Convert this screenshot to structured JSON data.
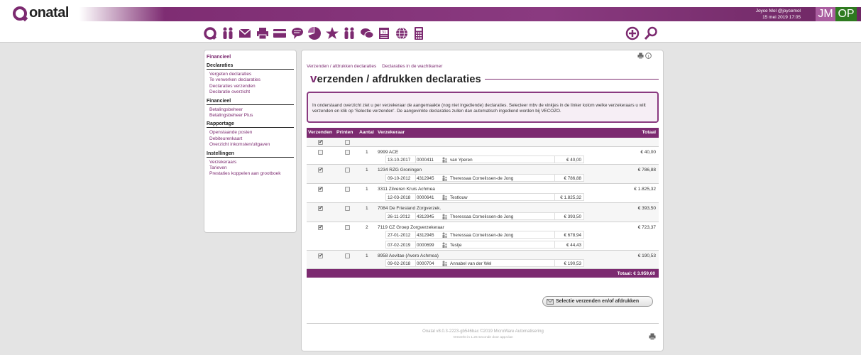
{
  "brand": {
    "name": "onatal",
    "color": "#7c2a70"
  },
  "user": {
    "name": "Joyce Mol @joycemol",
    "datetime": "15 mei 2019 17:05",
    "avatars": [
      "JM",
      "OP"
    ]
  },
  "toolbar": {
    "icons": [
      "onatal-q-icon",
      "clients-icon",
      "mail-icon",
      "print-icon",
      "card-icon",
      "chat-icon",
      "chart-icon",
      "star-icon",
      "group-icon",
      "messages-icon",
      "calendar-icon",
      "globe-icon",
      "calculator-icon"
    ],
    "right_icons": [
      "add-icon",
      "search-icon"
    ]
  },
  "sidebar": {
    "title": "Financieel",
    "sections": [
      {
        "heading": "Declaraties",
        "items": [
          "Vergeten declaraties",
          "Te verwerken declaraties",
          "Declaraties verzenden",
          "Declaratie overzicht"
        ]
      },
      {
        "heading": "Financieel",
        "items": [
          "Betalingsbeheer",
          "Betalingsbeheer Plus"
        ]
      },
      {
        "heading": "Rapportage",
        "items": [
          "Openstaande posten",
          "Debiteurenkaart",
          "Overzicht inkomsten/uitgaven"
        ]
      },
      {
        "heading": "Instellingen",
        "items": [
          "Verzekeraars",
          "Tarieven",
          "Prestaties koppelen aan grootboek"
        ]
      }
    ]
  },
  "main": {
    "breadcrumb": [
      "Verzenden / afdrukken declaraties",
      "Declaraties in de wachtkamer"
    ],
    "title_first": "v",
    "title_rest": "erzenden / afdrukken declaraties",
    "info": "In onderstaand overzicht ziet u per verzekeraar de aangemaakte (nog niet ingediende) declaraties. Selecteer mbv de vinkjes in de linker kolom welke verzekeraars u wilt verzenden en klik op 'Selectie verzenden'. De aangevinkte declaraties zullen dan automatisch ingediend worden bij VECOZO."
  },
  "table": {
    "headers": {
      "verzenden": "Verzenden",
      "printen": "Printen",
      "aantal": "Aantal",
      "verzekeraar": "Verzekeraar",
      "totaal": "Totaal"
    },
    "select_all": {
      "verzenden": true,
      "printen": false
    },
    "rows": [
      {
        "verzenden": false,
        "printen": false,
        "aantal": "1",
        "verzekeraar": "9999 ACE",
        "totaal": "€ 40,00",
        "subs": [
          {
            "date": "13-10-2017",
            "nr": "0000411",
            "patient": "van Yperen",
            "amount": "€ 40,00"
          }
        ]
      },
      {
        "verzenden": true,
        "printen": false,
        "aantal": "1",
        "verzekeraar": "1234 RZG Groningen",
        "totaal": "€ 786,88",
        "subs": [
          {
            "date": "09-10-2012",
            "nr": "4312945",
            "patient": "Theressaa Cornelissen-de Jong",
            "amount": "€ 786,88"
          }
        ]
      },
      {
        "verzenden": true,
        "printen": false,
        "aantal": "1",
        "verzekeraar": "3311 Zilveren Kruis Achmea",
        "totaal": "€ 1.825,32",
        "subs": [
          {
            "date": "12-03-2018",
            "nr": "0000641",
            "patient": "Testlouw",
            "amount": "€ 1.825,32"
          }
        ]
      },
      {
        "verzenden": true,
        "printen": false,
        "aantal": "1",
        "verzekeraar": "7084 De Friesland Zorgverzek.",
        "totaal": "€ 393,50",
        "subs": [
          {
            "date": "26-11-2012",
            "nr": "4312945",
            "patient": "Theressaa Cornelissen-de Jong",
            "amount": "€ 393,50"
          }
        ]
      },
      {
        "verzenden": true,
        "printen": false,
        "aantal": "2",
        "verzekeraar": "7119 CZ Groep Zorgverzekeraar",
        "totaal": "€ 723,37",
        "subs": [
          {
            "date": "27-01-2012",
            "nr": "4312945",
            "patient": "Theressaa Cornelissen-de Jong",
            "amount": "€ 678,94"
          },
          {
            "date": "07-02-2019",
            "nr": "0000699",
            "patient": "Testje",
            "amount": "€ 44,43"
          }
        ]
      },
      {
        "verzenden": true,
        "printen": false,
        "aantal": "1",
        "verzekeraar": "8958 Aevitae (Avero Achmea)",
        "totaal": "€ 190,53",
        "subs": [
          {
            "date": "09-02-2018",
            "nr": "0000704",
            "patient": "Annabel van der Wel",
            "amount": "€ 190,53"
          }
        ]
      }
    ],
    "total": "Totaal: € 3.959,60"
  },
  "action": {
    "label": "Selectie verzenden en/of afdrukken"
  },
  "footer": {
    "line1": "Onatal v8.0.3-2223-gb546bac ©2019 MicroWare Automatisering",
    "line2": "Verwerkt in 1.26 seconde door app4.lan"
  }
}
